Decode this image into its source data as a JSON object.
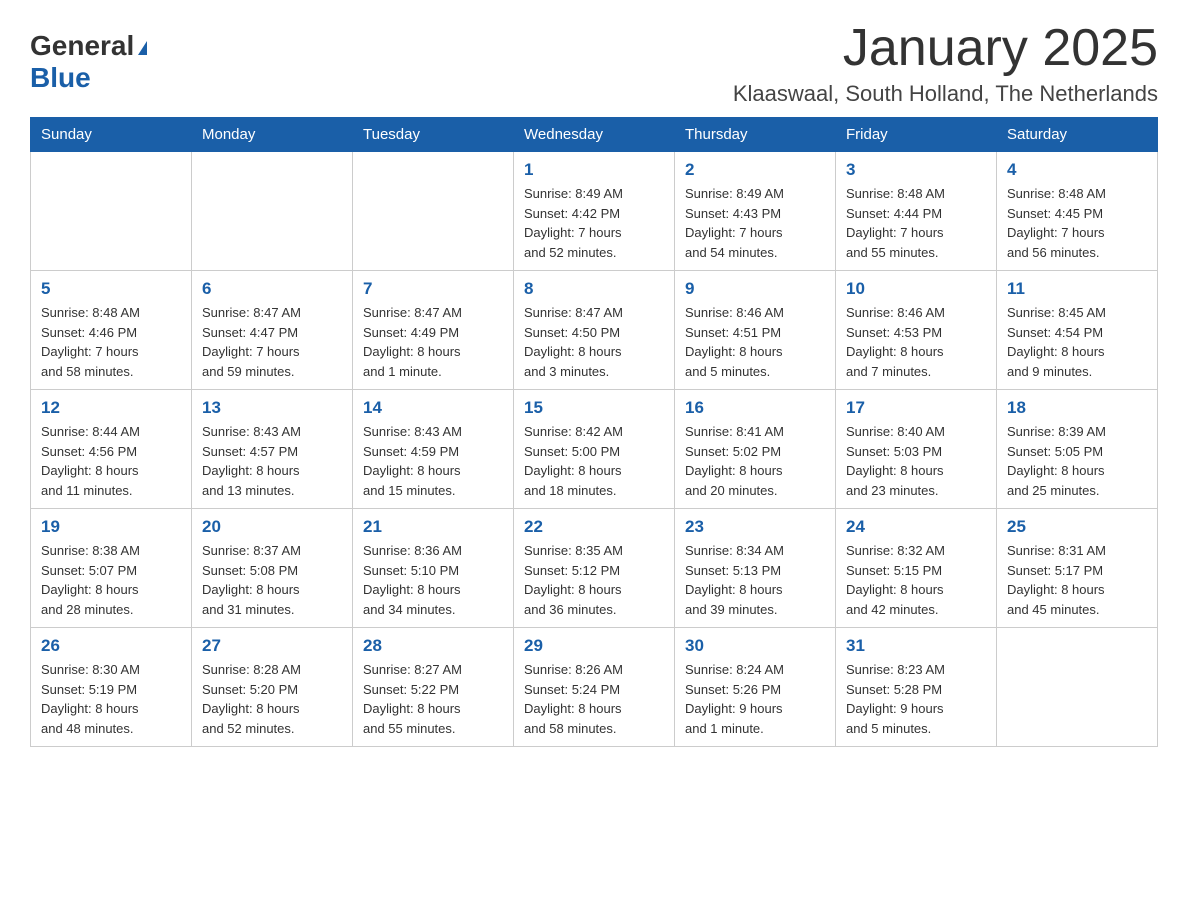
{
  "logo": {
    "general": "General",
    "blue": "Blue",
    "triangle": "▲"
  },
  "header": {
    "month_title": "January 2025",
    "location": "Klaaswaal, South Holland, The Netherlands"
  },
  "weekdays": [
    "Sunday",
    "Monday",
    "Tuesday",
    "Wednesday",
    "Thursday",
    "Friday",
    "Saturday"
  ],
  "weeks": [
    [
      {
        "day": "",
        "info": ""
      },
      {
        "day": "",
        "info": ""
      },
      {
        "day": "",
        "info": ""
      },
      {
        "day": "1",
        "info": "Sunrise: 8:49 AM\nSunset: 4:42 PM\nDaylight: 7 hours\nand 52 minutes."
      },
      {
        "day": "2",
        "info": "Sunrise: 8:49 AM\nSunset: 4:43 PM\nDaylight: 7 hours\nand 54 minutes."
      },
      {
        "day": "3",
        "info": "Sunrise: 8:48 AM\nSunset: 4:44 PM\nDaylight: 7 hours\nand 55 minutes."
      },
      {
        "day": "4",
        "info": "Sunrise: 8:48 AM\nSunset: 4:45 PM\nDaylight: 7 hours\nand 56 minutes."
      }
    ],
    [
      {
        "day": "5",
        "info": "Sunrise: 8:48 AM\nSunset: 4:46 PM\nDaylight: 7 hours\nand 58 minutes."
      },
      {
        "day": "6",
        "info": "Sunrise: 8:47 AM\nSunset: 4:47 PM\nDaylight: 7 hours\nand 59 minutes."
      },
      {
        "day": "7",
        "info": "Sunrise: 8:47 AM\nSunset: 4:49 PM\nDaylight: 8 hours\nand 1 minute."
      },
      {
        "day": "8",
        "info": "Sunrise: 8:47 AM\nSunset: 4:50 PM\nDaylight: 8 hours\nand 3 minutes."
      },
      {
        "day": "9",
        "info": "Sunrise: 8:46 AM\nSunset: 4:51 PM\nDaylight: 8 hours\nand 5 minutes."
      },
      {
        "day": "10",
        "info": "Sunrise: 8:46 AM\nSunset: 4:53 PM\nDaylight: 8 hours\nand 7 minutes."
      },
      {
        "day": "11",
        "info": "Sunrise: 8:45 AM\nSunset: 4:54 PM\nDaylight: 8 hours\nand 9 minutes."
      }
    ],
    [
      {
        "day": "12",
        "info": "Sunrise: 8:44 AM\nSunset: 4:56 PM\nDaylight: 8 hours\nand 11 minutes."
      },
      {
        "day": "13",
        "info": "Sunrise: 8:43 AM\nSunset: 4:57 PM\nDaylight: 8 hours\nand 13 minutes."
      },
      {
        "day": "14",
        "info": "Sunrise: 8:43 AM\nSunset: 4:59 PM\nDaylight: 8 hours\nand 15 minutes."
      },
      {
        "day": "15",
        "info": "Sunrise: 8:42 AM\nSunset: 5:00 PM\nDaylight: 8 hours\nand 18 minutes."
      },
      {
        "day": "16",
        "info": "Sunrise: 8:41 AM\nSunset: 5:02 PM\nDaylight: 8 hours\nand 20 minutes."
      },
      {
        "day": "17",
        "info": "Sunrise: 8:40 AM\nSunset: 5:03 PM\nDaylight: 8 hours\nand 23 minutes."
      },
      {
        "day": "18",
        "info": "Sunrise: 8:39 AM\nSunset: 5:05 PM\nDaylight: 8 hours\nand 25 minutes."
      }
    ],
    [
      {
        "day": "19",
        "info": "Sunrise: 8:38 AM\nSunset: 5:07 PM\nDaylight: 8 hours\nand 28 minutes."
      },
      {
        "day": "20",
        "info": "Sunrise: 8:37 AM\nSunset: 5:08 PM\nDaylight: 8 hours\nand 31 minutes."
      },
      {
        "day": "21",
        "info": "Sunrise: 8:36 AM\nSunset: 5:10 PM\nDaylight: 8 hours\nand 34 minutes."
      },
      {
        "day": "22",
        "info": "Sunrise: 8:35 AM\nSunset: 5:12 PM\nDaylight: 8 hours\nand 36 minutes."
      },
      {
        "day": "23",
        "info": "Sunrise: 8:34 AM\nSunset: 5:13 PM\nDaylight: 8 hours\nand 39 minutes."
      },
      {
        "day": "24",
        "info": "Sunrise: 8:32 AM\nSunset: 5:15 PM\nDaylight: 8 hours\nand 42 minutes."
      },
      {
        "day": "25",
        "info": "Sunrise: 8:31 AM\nSunset: 5:17 PM\nDaylight: 8 hours\nand 45 minutes."
      }
    ],
    [
      {
        "day": "26",
        "info": "Sunrise: 8:30 AM\nSunset: 5:19 PM\nDaylight: 8 hours\nand 48 minutes."
      },
      {
        "day": "27",
        "info": "Sunrise: 8:28 AM\nSunset: 5:20 PM\nDaylight: 8 hours\nand 52 minutes."
      },
      {
        "day": "28",
        "info": "Sunrise: 8:27 AM\nSunset: 5:22 PM\nDaylight: 8 hours\nand 55 minutes."
      },
      {
        "day": "29",
        "info": "Sunrise: 8:26 AM\nSunset: 5:24 PM\nDaylight: 8 hours\nand 58 minutes."
      },
      {
        "day": "30",
        "info": "Sunrise: 8:24 AM\nSunset: 5:26 PM\nDaylight: 9 hours\nand 1 minute."
      },
      {
        "day": "31",
        "info": "Sunrise: 8:23 AM\nSunset: 5:28 PM\nDaylight: 9 hours\nand 5 minutes."
      },
      {
        "day": "",
        "info": ""
      }
    ]
  ]
}
